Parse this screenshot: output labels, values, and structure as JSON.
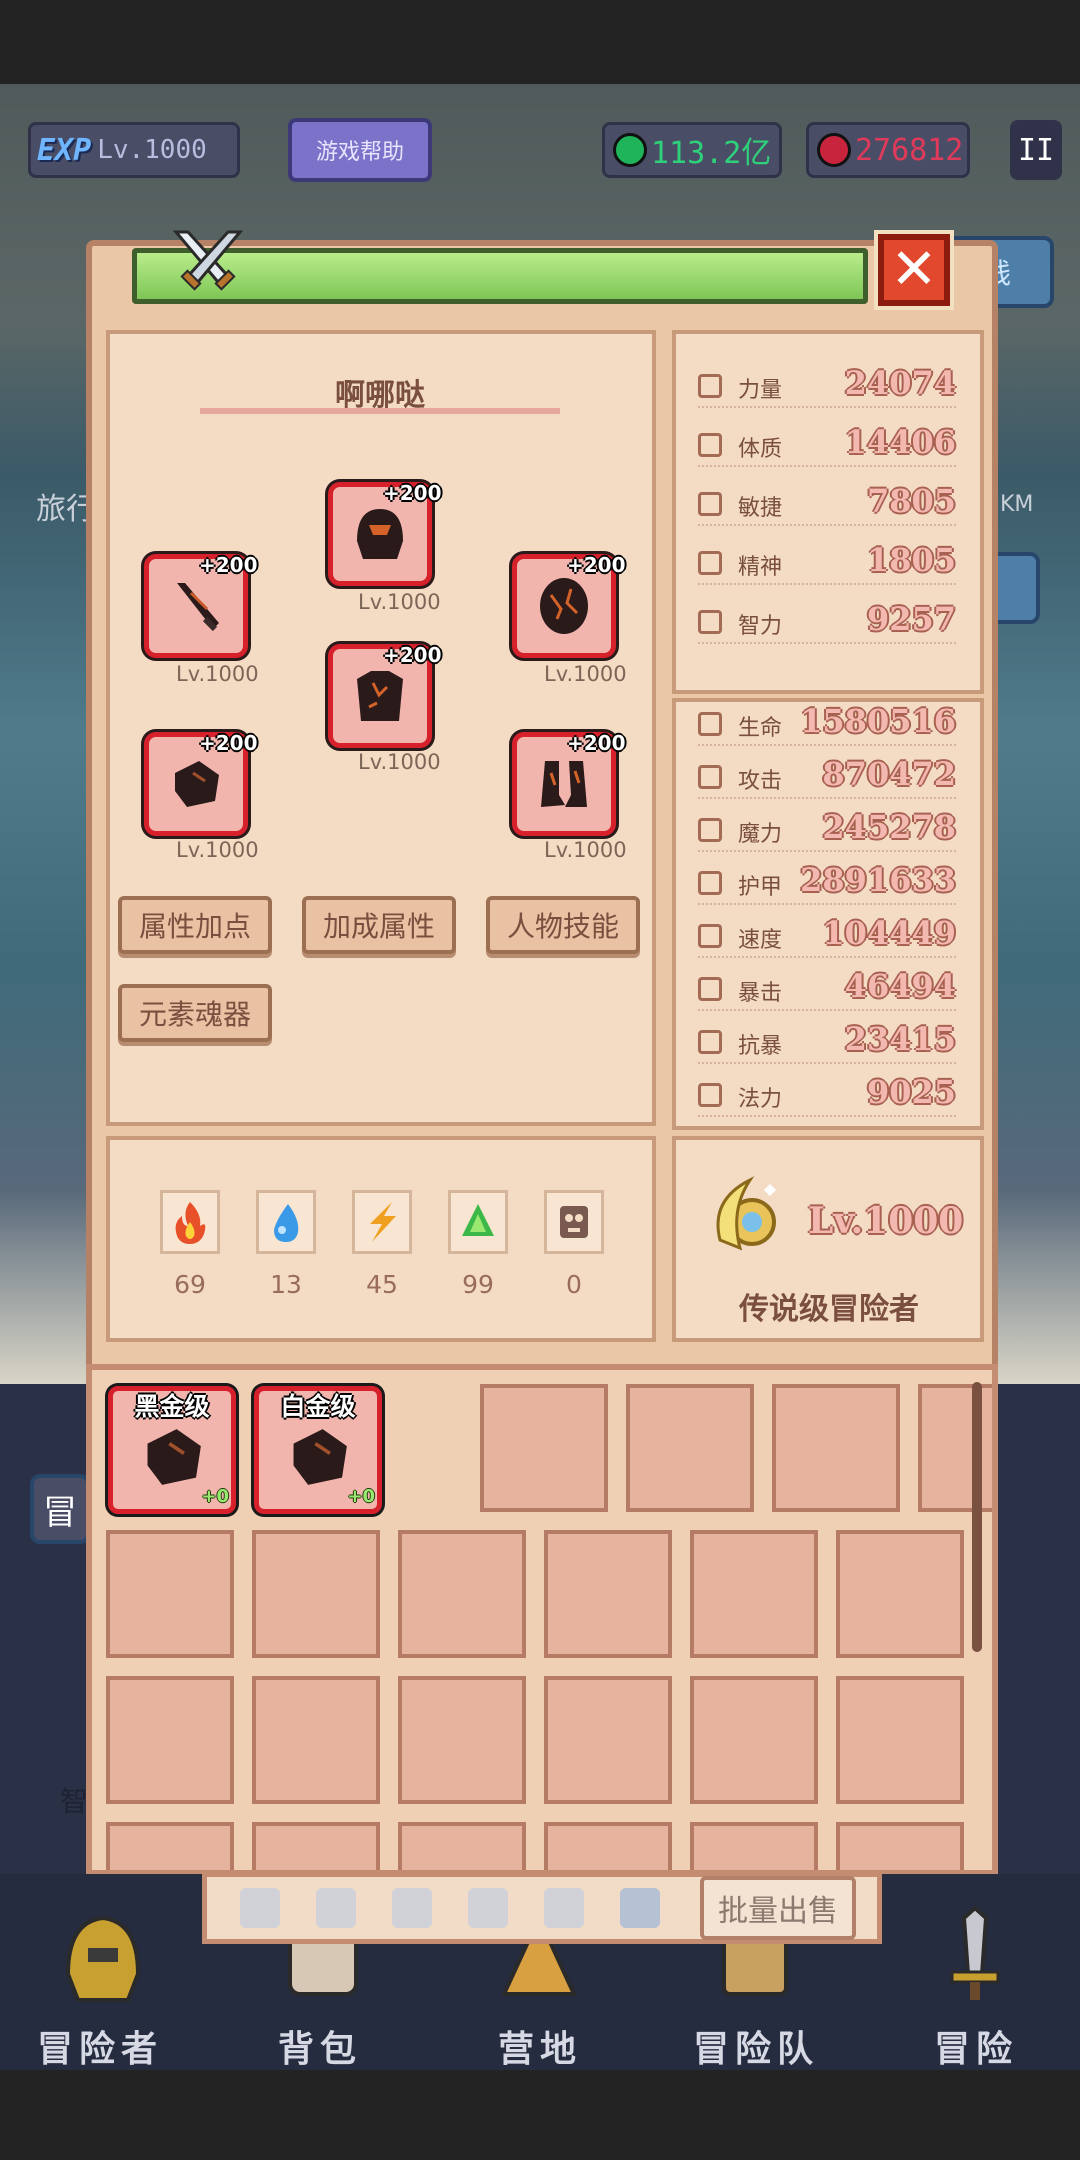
{
  "hud": {
    "exp_tag": "EXP",
    "level": "Lv.1000",
    "help_button": "游戏帮助",
    "emerald": "113.2亿",
    "ruby": "276812",
    "pause": "II"
  },
  "background": {
    "side_left": "旅行",
    "side_right": "KM",
    "button_right": "线",
    "tab_left": "冒",
    "tab_right": "智"
  },
  "character": {
    "name": "啊哪哒",
    "equipment": [
      {
        "slot": "helmet",
        "bonus": "+200",
        "level": "Lv.1000"
      },
      {
        "slot": "weapon",
        "bonus": "+200",
        "level": "Lv.1000"
      },
      {
        "slot": "shield",
        "bonus": "+200",
        "level": "Lv.1000"
      },
      {
        "slot": "armor",
        "bonus": "+200",
        "level": "Lv.1000"
      },
      {
        "slot": "gloves",
        "bonus": "+200",
        "level": "Lv.1000"
      },
      {
        "slot": "boots",
        "bonus": "+200",
        "level": "Lv.1000"
      }
    ],
    "buttons": [
      "属性加点",
      "加成属性",
      "人物技能",
      "元素魂器"
    ],
    "elements": [
      {
        "icon": "fire-element-icon",
        "value": "69",
        "color": "#e8502a"
      },
      {
        "icon": "water-element-icon",
        "value": "13",
        "color": "#3a9ae8"
      },
      {
        "icon": "lightning-element-icon",
        "value": "45",
        "color": "#f0a020"
      },
      {
        "icon": "wind-element-icon",
        "value": "99",
        "color": "#3cb848"
      },
      {
        "icon": "dark-element-icon",
        "value": "0",
        "color": "#7a5a50"
      }
    ]
  },
  "base_stats": [
    {
      "label": "力量",
      "value": "24074"
    },
    {
      "label": "体质",
      "value": "14406"
    },
    {
      "label": "敏捷",
      "value": "7805"
    },
    {
      "label": "精神",
      "value": "1805"
    },
    {
      "label": "智力",
      "value": "9257"
    }
  ],
  "combat_stats": [
    {
      "label": "生命",
      "value": "1580516"
    },
    {
      "label": "攻击",
      "value": "870472"
    },
    {
      "label": "魔力",
      "value": "245278"
    },
    {
      "label": "护甲",
      "value": "2891633"
    },
    {
      "label": "速度",
      "value": "104449"
    },
    {
      "label": "暴击",
      "value": "46494"
    },
    {
      "label": "抗暴",
      "value": "23415"
    },
    {
      "label": "法力",
      "value": "9025"
    }
  ],
  "rank": {
    "level": "Lv.1000",
    "title": "传说级冒险者"
  },
  "inventory": {
    "items": [
      {
        "grade": "黑金级",
        "bonus": "+0"
      },
      {
        "grade": "白金级",
        "bonus": "+0"
      }
    ],
    "sell_button": "批量出售",
    "filters": [
      "weapon-filter-icon",
      "shield-filter-icon",
      "skull-filter-icon",
      "helmet-filter-icon",
      "armor-filter-icon",
      "ring-filter-icon"
    ]
  },
  "nav": [
    "冒险者",
    "背包",
    "营地",
    "冒险队",
    "冒险"
  ],
  "colors": {
    "panel": "#e9c7a7",
    "slot_border": "#d6202c",
    "title_green": "#7fc656",
    "close_red": "#e1482e"
  }
}
